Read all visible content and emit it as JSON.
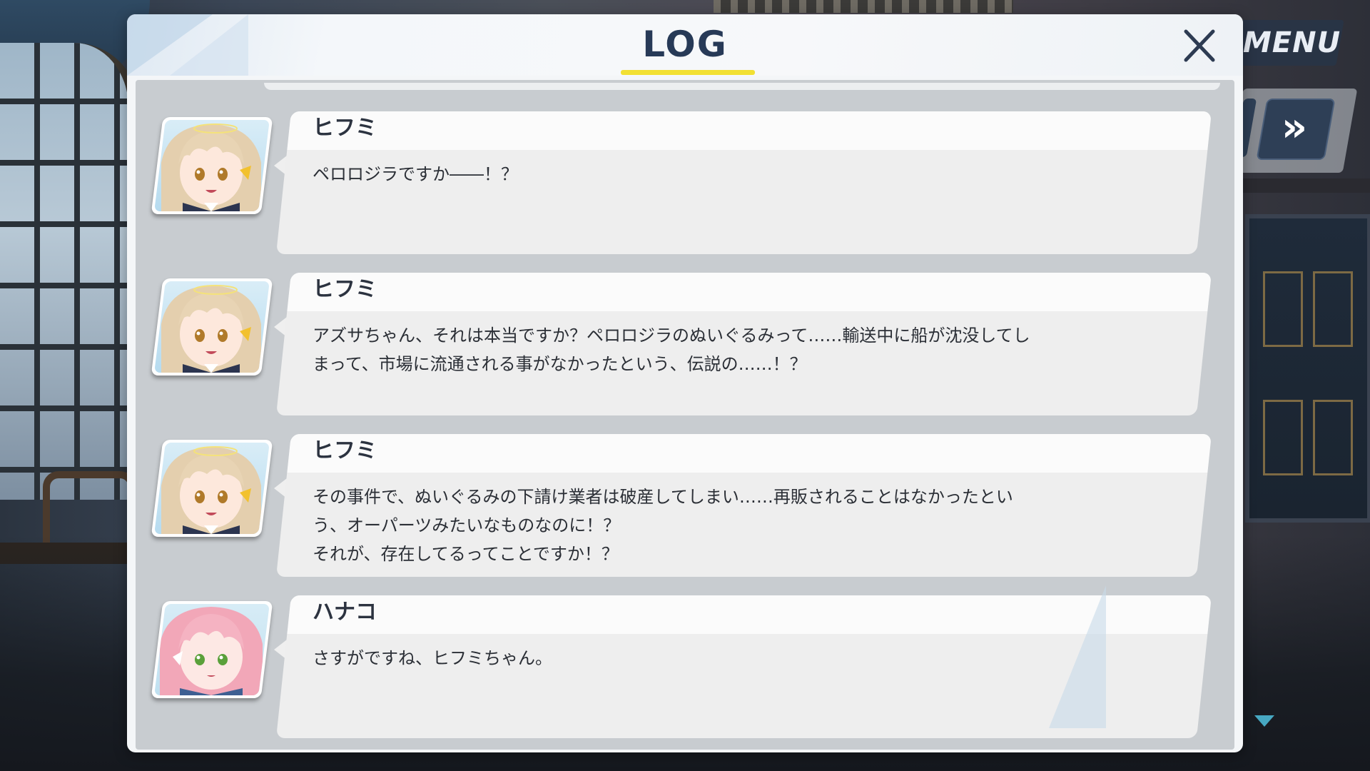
{
  "hud": {
    "menu_label": "MENU",
    "fast_forward_glyph": "»"
  },
  "log": {
    "title": "LOG",
    "entries": [
      {
        "speaker": "ヒフミ",
        "text": "ペロロジラですか――！？"
      },
      {
        "speaker": "ヒフミ",
        "text": "アズサちゃん、それは本当ですか？ペロロジラのぬいぐるみって……輸送中に船が沈没してし\nまって、市場に流通される事がなかったという、伝説の……！？"
      },
      {
        "speaker": "ヒフミ",
        "text": "その事件で、ぬいぐるみの下請け業者は破産してしまい……再販されることはなかったとい\nう、オーパーツみたいなものなのに！？\nそれが、存在してるってことですか！？"
      },
      {
        "speaker": "ハナコ",
        "text": "さすがですね、ヒフミちゃん。"
      }
    ]
  },
  "colors": {
    "title_text": "#273a57",
    "title_underline": "#f2e033",
    "scroll_indicator": "#47a8c2",
    "hifumi_hair": "#e4cfae",
    "hanako_hair": "#f2a7b8"
  }
}
